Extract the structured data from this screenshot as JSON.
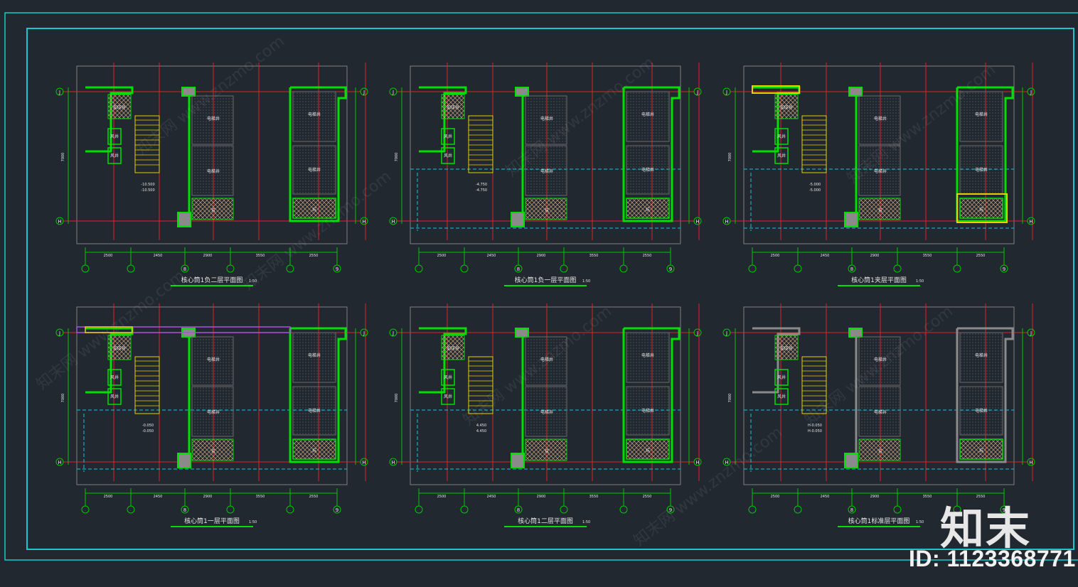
{
  "watermark": {
    "brand": "知末",
    "id_text": "ID: 1123368771",
    "diagonal_text": "知末网 www.znzmo.com"
  },
  "colors": {
    "background": "#212830",
    "frame": "#19c7cf",
    "wall": "#00e000",
    "axis": "#e5202a",
    "dash": "#17c5d6",
    "dim": "#00c800",
    "text": "#e6e6e6",
    "hatch": "#c8a07a",
    "yellow": "#e8d000",
    "grey": "#8a8a8a",
    "purple": "#b050e0"
  },
  "axis_labels": {
    "top": "J",
    "bottom": "H",
    "bottom_axes": [
      "",
      "",
      "8",
      "",
      "",
      "9"
    ]
  },
  "dimensions": {
    "bottom": [
      "2500",
      "2450",
      "2900",
      "3550",
      "2550"
    ],
    "vertical": "7000"
  },
  "room_labels": {
    "elevator": "电梯井",
    "duct": "风井",
    "equipment": "加压井",
    "pit": "坑"
  },
  "plans": [
    {
      "title": "核心筒1负二层平面图",
      "scale": "1:50",
      "elevations": [
        "-10.500",
        "-10.500"
      ],
      "variant": "b2"
    },
    {
      "title": "核心筒1负一层平面图",
      "scale": "1:50",
      "elevations": [
        "-4.750",
        "-4.750"
      ],
      "variant": "b1"
    },
    {
      "title": "核心筒1夹层平面图",
      "scale": "1:50",
      "elevations": [
        "-5.000",
        "-5.000"
      ],
      "variant": "mez"
    },
    {
      "title": "核心筒1一层平面图",
      "scale": "1:50",
      "elevations": [
        "-0.050",
        "-0.050"
      ],
      "variant": "f1"
    },
    {
      "title": "核心筒1二层平面图",
      "scale": "1:50",
      "elevations": [
        "4.450",
        "4.450"
      ],
      "variant": "f2"
    },
    {
      "title": "核心筒1标准层平面图",
      "scale": "1:50",
      "elevations": [
        "H-0.050",
        "H-0.050"
      ],
      "variant": "std"
    }
  ]
}
